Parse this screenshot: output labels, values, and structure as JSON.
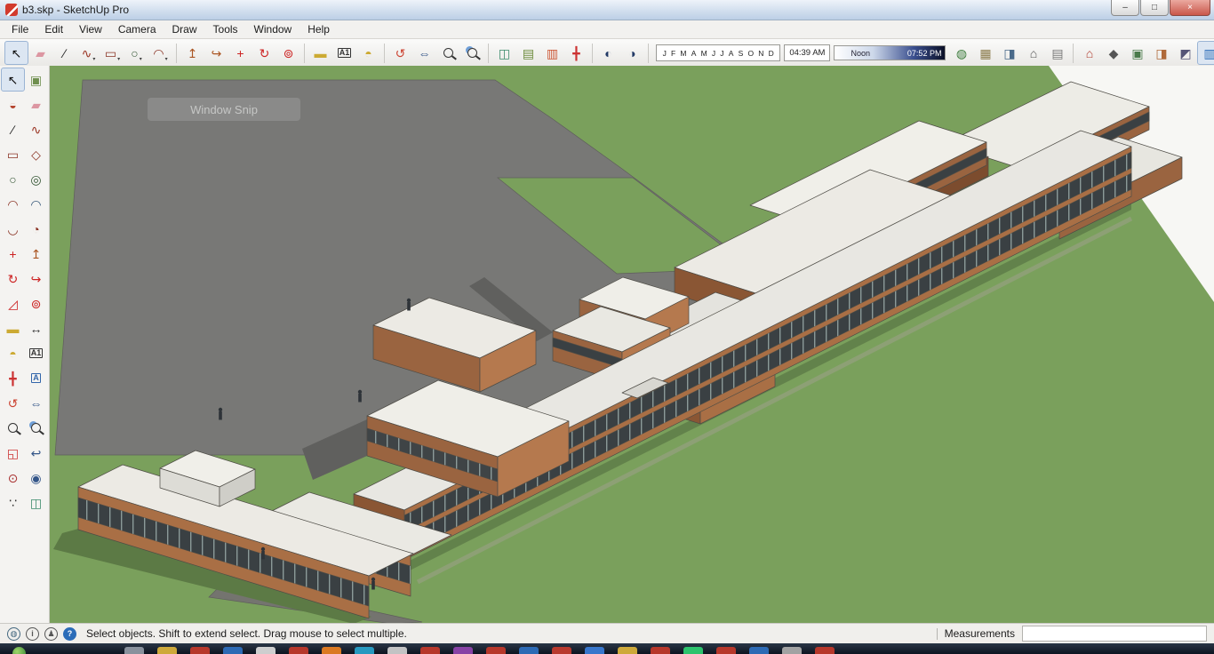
{
  "window": {
    "title": "b3.skp - SketchUp Pro"
  },
  "window_controls": [
    {
      "name": "minimize-button",
      "glyph": "–"
    },
    {
      "name": "maximize-button",
      "glyph": "□"
    },
    {
      "name": "close-button",
      "glyph": "×",
      "close": true
    }
  ],
  "menu": {
    "items": [
      "File",
      "Edit",
      "View",
      "Camera",
      "Draw",
      "Tools",
      "Window",
      "Help"
    ]
  },
  "top_toolbar": {
    "groups_left": [
      {
        "items": [
          {
            "name": "select-tool",
            "glyph": "↖",
            "color": "#111111",
            "pressed": true
          },
          {
            "name": "eraser-tool",
            "glyph": "▰",
            "color": "#dc96a2"
          },
          {
            "name": "line-tool",
            "glyph": "∕",
            "color": "#222222"
          },
          {
            "name": "freehand-tool",
            "glyph": "∿",
            "color": "#993322",
            "dd": true
          },
          {
            "name": "rectangle-tool",
            "glyph": "▭",
            "color": "#8a3324",
            "dd": true
          },
          {
            "name": "circle-tool",
            "glyph": "○",
            "color": "#335533",
            "dd": true
          },
          {
            "name": "arc-tool",
            "glyph": "◠",
            "color": "#8a3324",
            "dd": true
          }
        ]
      },
      {
        "items": [
          {
            "name": "push-pull-tool",
            "glyph": "↥",
            "color": "#aa5522"
          },
          {
            "name": "follow-me-tool",
            "glyph": "↪",
            "color": "#aa5522"
          },
          {
            "name": "move-tool",
            "glyph": "+",
            "color": "#cc2222"
          },
          {
            "name": "rotate-tool",
            "glyph": "↻",
            "color": "#cc2222"
          },
          {
            "name": "offset-tool",
            "glyph": "⊚",
            "color": "#cc2222"
          }
        ]
      },
      {
        "items": [
          {
            "name": "tape-measure-tool",
            "glyph": "▬",
            "color": "#ccaa33"
          },
          {
            "name": "text-tool",
            "glyph": "A1",
            "color": "#333333",
            "text": true
          },
          {
            "name": "protractor-tool",
            "glyph": "◓",
            "color": "#ccaa33"
          }
        ]
      },
      {
        "items": [
          {
            "name": "orbit-tool",
            "glyph": "↺",
            "color": "#cc4433"
          },
          {
            "name": "pan-tool",
            "glyph": "⇔",
            "color": "#335588"
          },
          {
            "name": "zoom-tool",
            "mag": true
          },
          {
            "name": "zoom-window-tool",
            "mag": true,
            "accent": true
          }
        ]
      },
      {
        "items": [
          {
            "name": "section-plane-tool",
            "glyph": "◫",
            "color": "#3a8a6a"
          },
          {
            "name": "section-fill-tool",
            "glyph": "▤",
            "color": "#6a8a3a"
          },
          {
            "name": "section-cut-tool",
            "glyph": "▥",
            "color": "#cc5533"
          },
          {
            "name": "axes-tool",
            "glyph": "╋",
            "color": "#cc3333"
          }
        ]
      },
      {
        "items": [
          {
            "name": "shadow-settings",
            "glyph": "◐",
            "color": "#223a66"
          },
          {
            "name": "shadow-toggle",
            "glyph": "◑",
            "color": "#223a66"
          }
        ]
      }
    ],
    "shadow": {
      "months": [
        "J",
        "F",
        "M",
        "A",
        "M",
        "J",
        "J",
        "A",
        "S",
        "O",
        "N",
        "D"
      ],
      "time_start": "04:39 AM",
      "noon_label": "Noon",
      "time_end": "07:52 PM"
    },
    "groups_right": [
      {
        "items": [
          {
            "name": "add-location",
            "glyph": "◍",
            "color": "#3a7a3a"
          },
          {
            "name": "toggle-terrain",
            "glyph": "▦",
            "color": "#8a7a4a"
          },
          {
            "name": "photo-textures",
            "glyph": "◨",
            "color": "#4a6a8a"
          },
          {
            "name": "preview-model",
            "glyph": "⌂",
            "color": "#555555"
          },
          {
            "name": "model-info",
            "glyph": "▤",
            "color": "#777777"
          }
        ]
      },
      {
        "items": [
          {
            "name": "3d-warehouse",
            "glyph": "⌂",
            "color": "#b03a2e"
          },
          {
            "name": "extension-warehouse",
            "glyph": "◆",
            "color": "#555555"
          },
          {
            "name": "components-panel",
            "glyph": "▣",
            "color": "#4a7a4a"
          },
          {
            "name": "materials-panel",
            "glyph": "◨",
            "color": "#b06a3a"
          },
          {
            "name": "styles-panel",
            "glyph": "◩",
            "color": "#555577"
          },
          {
            "name": "default-tray",
            "glyph": "▥",
            "color": "#2b6cb8",
            "pressed": true
          }
        ]
      }
    ]
  },
  "left_toolbar": {
    "tools": [
      {
        "name": "select-tool",
        "glyph": "↖",
        "color": "#111111",
        "pressed": true
      },
      {
        "name": "make-component-tool",
        "glyph": "▣",
        "color": "#6f8f4f"
      },
      {
        "name": "paint-bucket-tool",
        "glyph": "◒",
        "color": "#b5452f"
      },
      {
        "name": "eraser-tool",
        "glyph": "▰",
        "color": "#dc96a2"
      },
      {
        "name": "line-tool",
        "glyph": "∕",
        "color": "#222222"
      },
      {
        "name": "freehand-tool",
        "glyph": "∿",
        "color": "#993322"
      },
      {
        "name": "rectangle-tool",
        "glyph": "▭",
        "color": "#8a3324"
      },
      {
        "name": "rotated-rectangle-tool",
        "glyph": "◇",
        "color": "#8a3324"
      },
      {
        "name": "circle-tool",
        "glyph": "○",
        "color": "#335533"
      },
      {
        "name": "polygon-tool",
        "glyph": "◎",
        "color": "#335533"
      },
      {
        "name": "arc-tool",
        "glyph": "◠",
        "color": "#8a3324"
      },
      {
        "name": "two-point-arc-tool",
        "glyph": "◠",
        "color": "#335577"
      },
      {
        "name": "three-point-arc-tool",
        "glyph": "◡",
        "color": "#8a3324"
      },
      {
        "name": "pie-tool",
        "glyph": "◔",
        "color": "#8a3324"
      },
      {
        "name": "move-tool",
        "glyph": "+",
        "color": "#cc2222"
      },
      {
        "name": "push-pull-tool",
        "glyph": "↥",
        "color": "#aa5522"
      },
      {
        "name": "rotate-tool",
        "glyph": "↻",
        "color": "#cc2222"
      },
      {
        "name": "follow-me-tool",
        "glyph": "↪",
        "color": "#cc2222"
      },
      {
        "name": "scale-tool",
        "glyph": "◿",
        "color": "#cc2222"
      },
      {
        "name": "offset-tool",
        "glyph": "⊚",
        "color": "#cc2222"
      },
      {
        "name": "tape-measure-tool",
        "glyph": "▬",
        "color": "#ccaa33"
      },
      {
        "name": "dimension-tool",
        "glyph": "↔",
        "color": "#333333"
      },
      {
        "name": "protractor-tool",
        "glyph": "◓",
        "color": "#ccaa33"
      },
      {
        "name": "text-tool",
        "glyph": "A1",
        "color": "#333333",
        "text": true
      },
      {
        "name": "axes-tool",
        "glyph": "╋",
        "color": "#cc3333"
      },
      {
        "name": "3d-text-tool",
        "glyph": "A",
        "color": "#3366aa",
        "text": true
      },
      {
        "name": "orbit-tool",
        "glyph": "↺",
        "color": "#cc4433"
      },
      {
        "name": "pan-tool",
        "glyph": "⇔",
        "color": "#335588"
      },
      {
        "name": "zoom-tool",
        "mag": true
      },
      {
        "name": "zoom-window-tool",
        "mag": true,
        "accent": true
      },
      {
        "name": "zoom-extents-tool",
        "glyph": "◱",
        "color": "#cc3333"
      },
      {
        "name": "previous-view-tool",
        "glyph": "↩",
        "color": "#335588"
      },
      {
        "name": "position-camera-tool",
        "glyph": "⊙",
        "color": "#aa3333"
      },
      {
        "name": "look-around-tool",
        "glyph": "◉",
        "color": "#335588"
      },
      {
        "name": "walk-tool",
        "glyph": "∵",
        "color": "#333333"
      },
      {
        "name": "section-plane-tool",
        "glyph": "◫",
        "color": "#3a8a6a"
      }
    ]
  },
  "viewport": {
    "watermark": "Window Snip"
  },
  "statusbar": {
    "icons": [
      {
        "name": "geolocation-icon",
        "glyph": "◍",
        "color": "#44687f"
      },
      {
        "name": "credits-icon",
        "glyph": "i",
        "color": "#555555"
      },
      {
        "name": "sign-in-icon",
        "glyph": "♟",
        "color": "#555555"
      },
      {
        "name": "help-icon",
        "glyph": "?",
        "color": "#ffffff",
        "bg": "#2b6cb8"
      }
    ],
    "message": "Select objects. Shift to extend select. Drag mouse to select multiple.",
    "measurements_label": "Measurements",
    "measurements_value": ""
  },
  "taskbar": {
    "colors": [
      "#8f98a3",
      "#d8b13c",
      "#c0392b",
      "#2e6fbd",
      "#d8d8d8",
      "#c0392b",
      "#e67e22",
      "#28a0c8",
      "#cccccc",
      "#c0392b",
      "#8e44ad",
      "#c0392b",
      "#2e6fbd",
      "#c23b2e",
      "#3a7bd5",
      "#d8b13c",
      "#c0392b",
      "#2ecc71",
      "#c0392b",
      "#2e6fbd",
      "#aaaaaa",
      "#c0392b"
    ]
  },
  "colors": {
    "ground": "#7aa05c",
    "pavement": "#787876",
    "sky": "#f7f7f4",
    "roof": "#eceae4",
    "brick_lit": "#a96f45",
    "brick_shade": "#8a5634",
    "window_band": "#3a4043",
    "accent_blue": "#2b6cb8"
  }
}
